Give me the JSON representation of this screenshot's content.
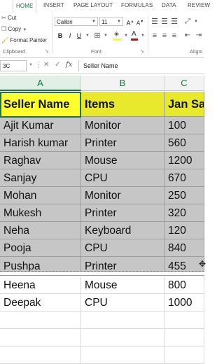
{
  "ribbon_tabs": [
    "HOME",
    "INSERT",
    "PAGE LAYOUT",
    "FORMULAS",
    "DATA",
    "REVIEW"
  ],
  "clipboard": {
    "cut": "Cut",
    "copy": "Copy",
    "format_painter": "Format Painter",
    "label": "Clipboard"
  },
  "font": {
    "name": "Calibri",
    "size": "11",
    "label": "Font",
    "bold": "B",
    "italic": "I",
    "underline": "U"
  },
  "alignment_label": "Aligni",
  "formula_bar": {
    "name_box": "3C",
    "formula": "Seller Name"
  },
  "columns": [
    "A",
    "B",
    "C"
  ],
  "table": {
    "headers": [
      "Seller Name",
      "Items",
      "Jan Sal"
    ],
    "rows": [
      [
        "Ajit Kumar",
        "Monitor",
        "100"
      ],
      [
        "Harish kumar",
        "Printer",
        "560"
      ],
      [
        "Raghav",
        "Mouse",
        "1200"
      ],
      [
        "Sanjay",
        "CPU",
        "670"
      ],
      [
        "Mohan",
        "Monitor",
        "250"
      ],
      [
        "Mukesh",
        "Printer",
        "320"
      ],
      [
        "Neha",
        "Keyboard",
        "120"
      ],
      [
        "Pooja",
        "CPU",
        "840"
      ],
      [
        "Pushpa",
        "Printer",
        "455"
      ],
      [
        "Heena",
        "Mouse",
        "800"
      ],
      [
        "Deepak",
        "CPU",
        "1000"
      ]
    ]
  },
  "colors": {
    "accent": "#217346",
    "header_fill": "#ffff2d",
    "shaded_fill": "#c6c6c6"
  }
}
